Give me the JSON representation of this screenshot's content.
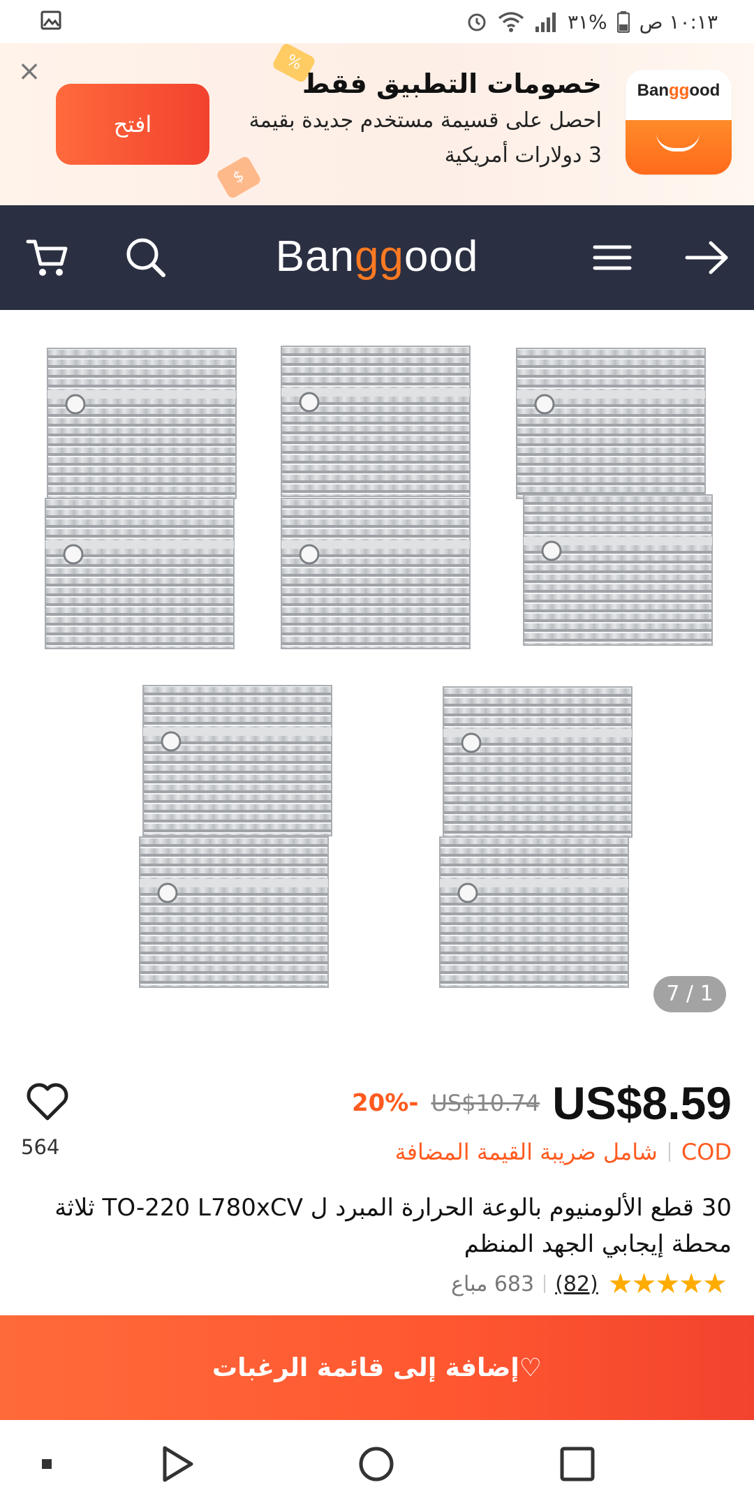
{
  "status_bar": {
    "time": "١٠:١٣ ص",
    "battery": "٣١%"
  },
  "app_banner": {
    "title": "خصومات التطبيق فقط",
    "subtitle_line1": "احصل على قسيمة مستخدم جديدة بقيمة",
    "subtitle_line2": "3 دولارات أمريكية",
    "open_button": "افتح",
    "logo_text_pre": "Ban",
    "logo_text_gg": "gg",
    "logo_text_post": "ood",
    "deco_percent": "%",
    "deco_dollar": "$"
  },
  "header": {
    "logo_pre": "Ban",
    "logo_gg": "gg",
    "logo_post": "ood"
  },
  "gallery": {
    "indicator": "7 / 1"
  },
  "product": {
    "price": "US$8.59",
    "old_price": "US$10.74",
    "discount": "20%-",
    "cod": "COD",
    "vat": "شامل ضريبة القيمة المضافة",
    "wishlist_count": "564",
    "title": "30 قطع الألومنيوم بالوعة الحرارة المبرد ل TO-220 L780xCV ثلاثة محطة إيجابي الجهد المنظم",
    "rating": 5,
    "reviews": "(82)",
    "sold": "683 مباع"
  },
  "wishlist_bar": {
    "label": "♡إضافة إلى قائمة الرغبات"
  },
  "colors": {
    "accent": "#ff5a1f",
    "header_bg": "#2b2f42",
    "star": "#ffab00"
  }
}
